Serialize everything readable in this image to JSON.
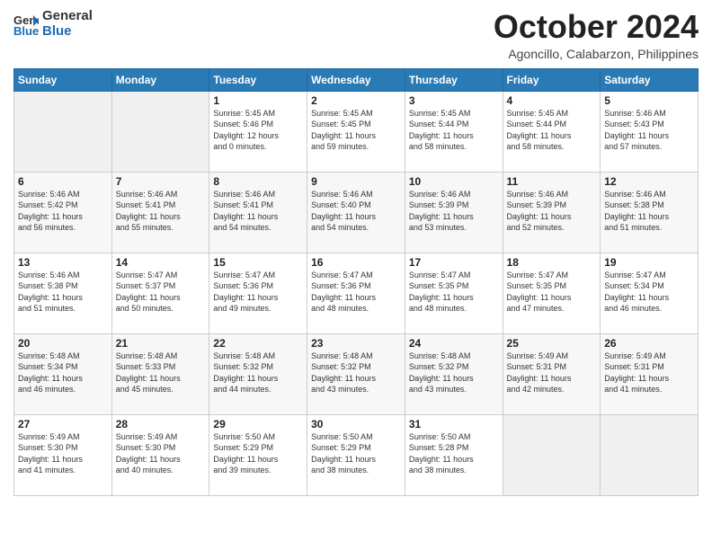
{
  "logo": {
    "line1": "General",
    "line2": "Blue"
  },
  "header": {
    "month": "October 2024",
    "location": "Agoncillo, Calabarzon, Philippines"
  },
  "weekdays": [
    "Sunday",
    "Monday",
    "Tuesday",
    "Wednesday",
    "Thursday",
    "Friday",
    "Saturday"
  ],
  "weeks": [
    [
      {
        "day": "",
        "info": ""
      },
      {
        "day": "",
        "info": ""
      },
      {
        "day": "1",
        "info": "Sunrise: 5:45 AM\nSunset: 5:46 PM\nDaylight: 12 hours\nand 0 minutes."
      },
      {
        "day": "2",
        "info": "Sunrise: 5:45 AM\nSunset: 5:45 PM\nDaylight: 11 hours\nand 59 minutes."
      },
      {
        "day": "3",
        "info": "Sunrise: 5:45 AM\nSunset: 5:44 PM\nDaylight: 11 hours\nand 58 minutes."
      },
      {
        "day": "4",
        "info": "Sunrise: 5:45 AM\nSunset: 5:44 PM\nDaylight: 11 hours\nand 58 minutes."
      },
      {
        "day": "5",
        "info": "Sunrise: 5:46 AM\nSunset: 5:43 PM\nDaylight: 11 hours\nand 57 minutes."
      }
    ],
    [
      {
        "day": "6",
        "info": "Sunrise: 5:46 AM\nSunset: 5:42 PM\nDaylight: 11 hours\nand 56 minutes."
      },
      {
        "day": "7",
        "info": "Sunrise: 5:46 AM\nSunset: 5:41 PM\nDaylight: 11 hours\nand 55 minutes."
      },
      {
        "day": "8",
        "info": "Sunrise: 5:46 AM\nSunset: 5:41 PM\nDaylight: 11 hours\nand 54 minutes."
      },
      {
        "day": "9",
        "info": "Sunrise: 5:46 AM\nSunset: 5:40 PM\nDaylight: 11 hours\nand 54 minutes."
      },
      {
        "day": "10",
        "info": "Sunrise: 5:46 AM\nSunset: 5:39 PM\nDaylight: 11 hours\nand 53 minutes."
      },
      {
        "day": "11",
        "info": "Sunrise: 5:46 AM\nSunset: 5:39 PM\nDaylight: 11 hours\nand 52 minutes."
      },
      {
        "day": "12",
        "info": "Sunrise: 5:46 AM\nSunset: 5:38 PM\nDaylight: 11 hours\nand 51 minutes."
      }
    ],
    [
      {
        "day": "13",
        "info": "Sunrise: 5:46 AM\nSunset: 5:38 PM\nDaylight: 11 hours\nand 51 minutes."
      },
      {
        "day": "14",
        "info": "Sunrise: 5:47 AM\nSunset: 5:37 PM\nDaylight: 11 hours\nand 50 minutes."
      },
      {
        "day": "15",
        "info": "Sunrise: 5:47 AM\nSunset: 5:36 PM\nDaylight: 11 hours\nand 49 minutes."
      },
      {
        "day": "16",
        "info": "Sunrise: 5:47 AM\nSunset: 5:36 PM\nDaylight: 11 hours\nand 48 minutes."
      },
      {
        "day": "17",
        "info": "Sunrise: 5:47 AM\nSunset: 5:35 PM\nDaylight: 11 hours\nand 48 minutes."
      },
      {
        "day": "18",
        "info": "Sunrise: 5:47 AM\nSunset: 5:35 PM\nDaylight: 11 hours\nand 47 minutes."
      },
      {
        "day": "19",
        "info": "Sunrise: 5:47 AM\nSunset: 5:34 PM\nDaylight: 11 hours\nand 46 minutes."
      }
    ],
    [
      {
        "day": "20",
        "info": "Sunrise: 5:48 AM\nSunset: 5:34 PM\nDaylight: 11 hours\nand 46 minutes."
      },
      {
        "day": "21",
        "info": "Sunrise: 5:48 AM\nSunset: 5:33 PM\nDaylight: 11 hours\nand 45 minutes."
      },
      {
        "day": "22",
        "info": "Sunrise: 5:48 AM\nSunset: 5:32 PM\nDaylight: 11 hours\nand 44 minutes."
      },
      {
        "day": "23",
        "info": "Sunrise: 5:48 AM\nSunset: 5:32 PM\nDaylight: 11 hours\nand 43 minutes."
      },
      {
        "day": "24",
        "info": "Sunrise: 5:48 AM\nSunset: 5:32 PM\nDaylight: 11 hours\nand 43 minutes."
      },
      {
        "day": "25",
        "info": "Sunrise: 5:49 AM\nSunset: 5:31 PM\nDaylight: 11 hours\nand 42 minutes."
      },
      {
        "day": "26",
        "info": "Sunrise: 5:49 AM\nSunset: 5:31 PM\nDaylight: 11 hours\nand 41 minutes."
      }
    ],
    [
      {
        "day": "27",
        "info": "Sunrise: 5:49 AM\nSunset: 5:30 PM\nDaylight: 11 hours\nand 41 minutes."
      },
      {
        "day": "28",
        "info": "Sunrise: 5:49 AM\nSunset: 5:30 PM\nDaylight: 11 hours\nand 40 minutes."
      },
      {
        "day": "29",
        "info": "Sunrise: 5:50 AM\nSunset: 5:29 PM\nDaylight: 11 hours\nand 39 minutes."
      },
      {
        "day": "30",
        "info": "Sunrise: 5:50 AM\nSunset: 5:29 PM\nDaylight: 11 hours\nand 38 minutes."
      },
      {
        "day": "31",
        "info": "Sunrise: 5:50 AM\nSunset: 5:28 PM\nDaylight: 11 hours\nand 38 minutes."
      },
      {
        "day": "",
        "info": ""
      },
      {
        "day": "",
        "info": ""
      }
    ]
  ]
}
